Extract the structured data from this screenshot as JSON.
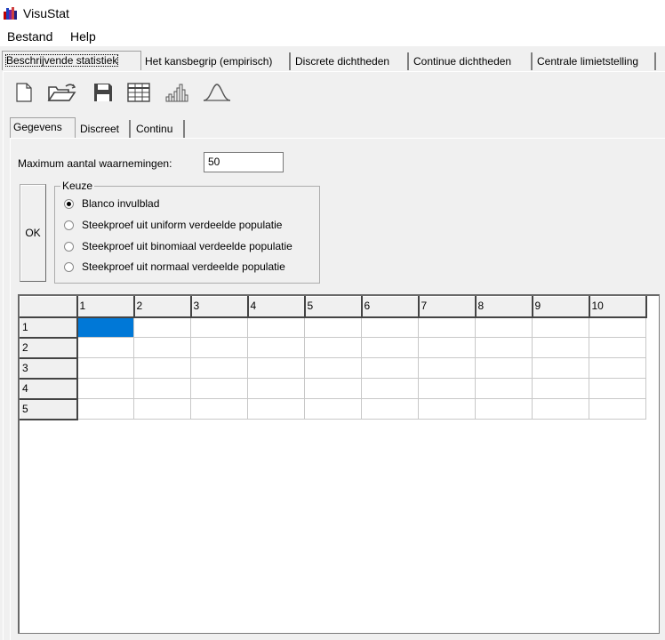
{
  "app": {
    "title": "VisuStat"
  },
  "menu": {
    "items": [
      "Bestand",
      "Help"
    ]
  },
  "main_tabs": [
    "Beschrijvende statistiek",
    "Het kansbegrip (empirisch)",
    "Discrete dichtheden",
    "Continue dichtheden",
    "Centrale limietstelling"
  ],
  "toolbar": {
    "icons": [
      "new-file-icon",
      "open-folder-icon",
      "save-icon",
      "table-icon",
      "histogram-icon",
      "bell-curve-icon"
    ]
  },
  "sub_tabs": [
    "Gegevens",
    "Discreet",
    "Continu"
  ],
  "form": {
    "max_label": "Maximum aantal waarnemingen:",
    "max_value": "50",
    "ok_label": "OK",
    "group_title": "Keuze",
    "options": [
      "Blanco invulblad",
      "Steekproef uit uniform verdeelde populatie",
      "Steekproef uit binomiaal verdeelde populatie",
      "Steekproef uit normaal verdeelde populatie"
    ],
    "selected_option": 0
  },
  "grid": {
    "column_headers": [
      "1",
      "2",
      "3",
      "4",
      "5",
      "6",
      "7",
      "8",
      "9",
      "10"
    ],
    "row_headers": [
      "1",
      "2",
      "3",
      "4",
      "5"
    ],
    "selected_cell": {
      "row": 1,
      "col": 1
    }
  },
  "colors": {
    "selection": "#0078d7",
    "background": "#f0f0f0"
  }
}
